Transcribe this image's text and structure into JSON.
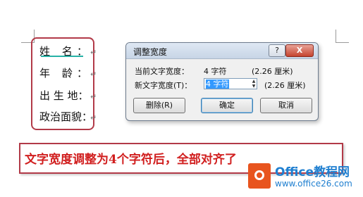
{
  "document": {
    "lines": [
      "姓 名：",
      "年 龄：",
      "出 生 地：",
      "政治面貌："
    ],
    "paragraph_mark": "↵"
  },
  "dialog": {
    "title": "调整宽度",
    "help_label": "?",
    "close_label": "X",
    "current_width_label": "当前文字宽度：",
    "current_width_chars": "4 字符",
    "current_width_cm": "(2.26 厘米)",
    "new_width_label": "新文字宽度(T)：",
    "new_width_value": "4 字符",
    "new_width_cm": "(2.26 厘米)",
    "delete_label": "删除(R)",
    "ok_label": "确定",
    "cancel_label": "取消"
  },
  "note": {
    "text": "文字宽度调整为4个字符后，全部对齐了"
  },
  "logo": {
    "name": "Office教程网",
    "url": "www.office26.com"
  },
  "colors": {
    "highlight_box": "#b23a48",
    "note_text": "#d11f1f",
    "logo_orange": "#e8541e",
    "logo_blue": "#1f7fd0"
  }
}
